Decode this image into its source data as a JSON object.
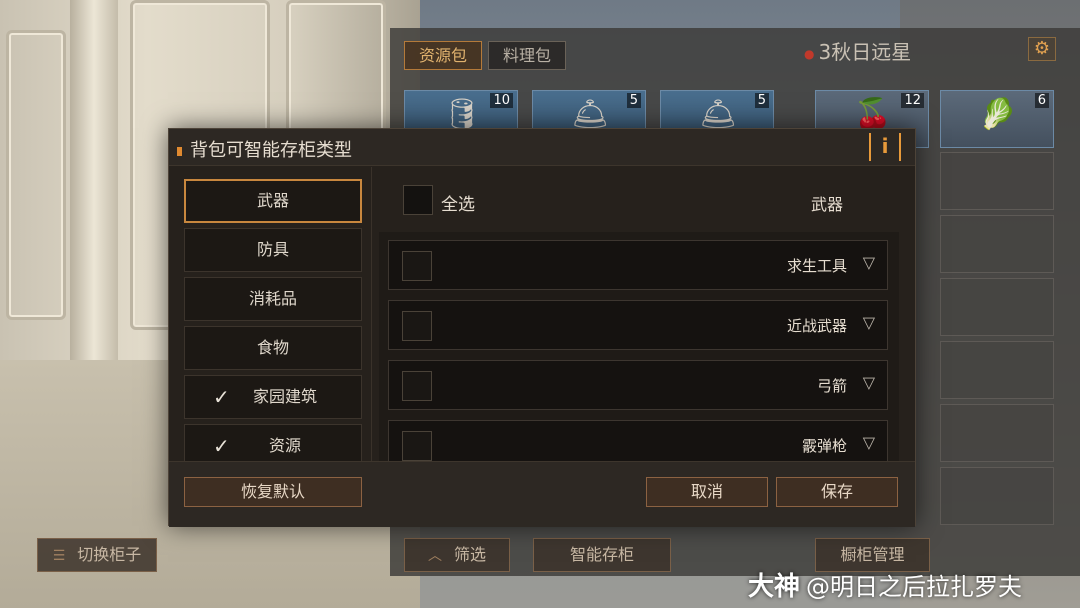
{
  "storage": {
    "tabs": [
      {
        "label": "资源包",
        "active": true
      },
      {
        "label": "料理包",
        "active": false
      }
    ],
    "cabinet_title": "3秋日远星",
    "items_left": [
      {
        "icon": "fuel-can-icon",
        "count": "10"
      },
      {
        "icon": "lamp-icon",
        "count": "5"
      },
      {
        "icon": "lamp-icon",
        "count": "5"
      }
    ],
    "items_right": [
      {
        "icon": "berries-icon",
        "count": "12"
      },
      {
        "icon": "greens-icon",
        "count": "6"
      }
    ],
    "switch_cabinet_label": "切换柜子",
    "filter_label": "筛选",
    "smart_store_label": "智能存柜",
    "cabinet_manage_label": "橱柜管理"
  },
  "dialog": {
    "title": "背包可智能存柜类型",
    "info_icon": "i",
    "categories": [
      {
        "label": "武器",
        "selected": true,
        "checked": false
      },
      {
        "label": "防具",
        "selected": false,
        "checked": false
      },
      {
        "label": "消耗品",
        "selected": false,
        "checked": false
      },
      {
        "label": "食物",
        "selected": false,
        "checked": false
      },
      {
        "label": "家园建筑",
        "selected": false,
        "checked": true
      },
      {
        "label": "资源",
        "selected": false,
        "checked": true
      }
    ],
    "select_all_label": "全选",
    "current_category": "武器",
    "subcategories": [
      {
        "label": "求生工具"
      },
      {
        "label": "近战武器"
      },
      {
        "label": "弓箭"
      },
      {
        "label": "霰弹枪"
      }
    ],
    "reset_label": "恢复默认",
    "cancel_label": "取消",
    "save_label": "保存"
  },
  "watermark": {
    "logo": "大神",
    "handle": "@明日之后拉扎罗夫"
  },
  "colors": {
    "accent_orange": "#e08a30",
    "selected_border": "#c8873e",
    "dialog_bg": "#26211c"
  }
}
